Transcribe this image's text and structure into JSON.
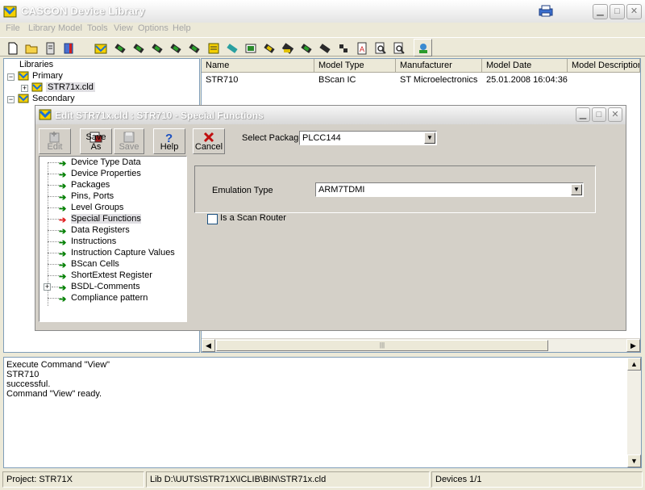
{
  "window": {
    "title": "CASCON Device Library"
  },
  "menu": [
    "File",
    "Library",
    "Model",
    "Tools",
    "View",
    "Options",
    "Help"
  ],
  "library_tree": {
    "header": "Libraries",
    "groups": [
      {
        "label": "Primary",
        "children": [
          "STR71x.cld"
        ]
      },
      {
        "label": "Secondary"
      }
    ]
  },
  "device_list": {
    "columns": [
      "Name",
      "Model Type",
      "Manufacturer",
      "Model Date",
      "Model Description"
    ],
    "rows": [
      [
        "STR710",
        "BScan IC",
        "ST Microelectronics",
        "25.01.2008 16:04:36",
        ""
      ]
    ]
  },
  "output": {
    "lines": [
      "Execute Command \"View\"",
      "STR710",
      "successful.",
      "Command \"View\" ready."
    ]
  },
  "status": {
    "project": "Project: STR71X",
    "library": "Lib D:\\UUTS\\STR71X\\ICLIB\\BIN\\STR71x.cld",
    "devices": "Devices 1/1"
  },
  "dialog": {
    "title": "Edit  STR71x.cld : STR710 - Special Functions",
    "toolbar": {
      "edit": "Edit",
      "save_as": "Save As",
      "save": "Save",
      "help": "Help",
      "cancel": "Cancel"
    },
    "function_tree": [
      "Device Type Data",
      "Device Properties",
      "Packages",
      "Pins, Ports",
      "Level Groups",
      "Special Functions",
      "Data Registers",
      "Instructions",
      "Instruction Capture Values",
      "BScan Cells",
      "ShortExtest Register",
      "BSDL-Comments",
      "Compliance pattern"
    ],
    "selected_function": "Special Functions",
    "select_package_label": "Select Package",
    "select_package_value": "PLCC144",
    "emulation_type_label": "Emulation Type",
    "emulation_type_value": "ARM7TDMI",
    "scan_router_label": "Is a Scan Router",
    "scan_router_checked": false
  },
  "colors": {
    "accent_arrow_green": "#007f00",
    "selected_arrow_red": "#e02020",
    "window_bg": "#ece9d8",
    "dialog_bg": "#d4d0c8"
  }
}
